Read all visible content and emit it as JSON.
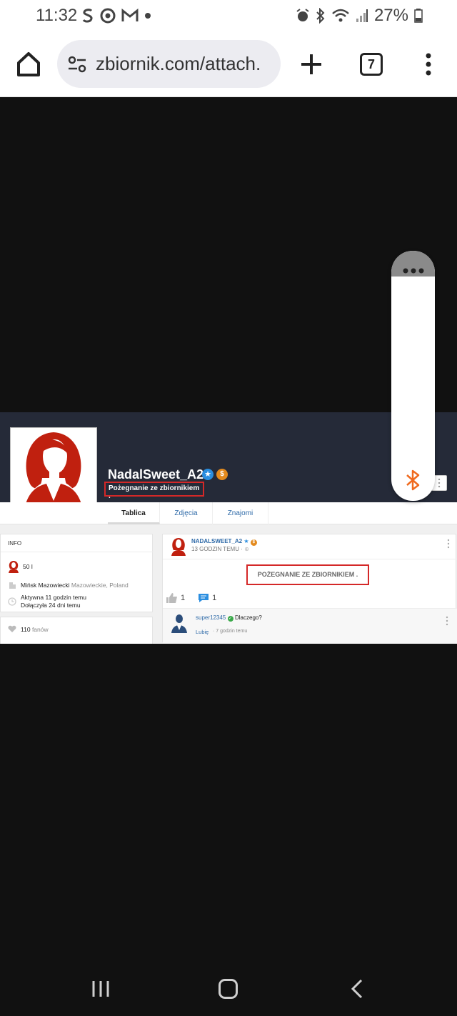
{
  "status_bar": {
    "time": "11:32",
    "battery": "27%",
    "left_icons": [
      "s-app-icon",
      "chrome-icon",
      "gmail-icon",
      "dot-icon"
    ],
    "right_icons": [
      "alarm-icon",
      "bluetooth-icon",
      "wifi-icon",
      "signal-icon",
      "battery-icon"
    ]
  },
  "browser": {
    "url": "zbiornik.com/attach.",
    "tab_count": "7"
  },
  "profile": {
    "name": "NadalSweet_A2",
    "status_message": "Pożegnanie ze zbiornikiem .",
    "tabs": [
      {
        "label": "Tablica",
        "active": true
      },
      {
        "label": "Zdjęcia",
        "active": false
      },
      {
        "label": "Znajomi",
        "active": false
      }
    ]
  },
  "info": {
    "header": "INFO",
    "age": "50 l",
    "city": "Mińsk Mazowiecki",
    "region": "Mazowieckie, Poland",
    "active": "Aktywna 11 godzin temu",
    "joined": "Dołączyła 24 dni temu",
    "fans_count": "110",
    "fans_label": "fanów"
  },
  "post": {
    "author": "NADALSWEET_A2",
    "time": "13 GODZIN TEMU ·",
    "body": "POŻEGNANIE ZE ZBIORNIKIEM .",
    "likes": "1",
    "comments": "1",
    "comment": {
      "user": "super12345",
      "text": "Dlaczego?",
      "like_label": "Lubię",
      "time": "· 7 godzin temu"
    }
  },
  "colors": {
    "cover": "#252a38",
    "accent_red": "#d42828",
    "link_blue": "#2e6aa8",
    "bluetooth_orange": "#f06a1e"
  }
}
